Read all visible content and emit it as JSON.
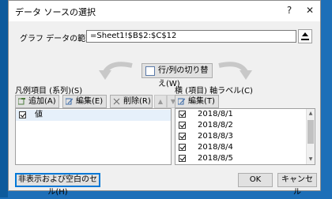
{
  "window": {
    "title": "データ ソースの選択",
    "help": "?",
    "close": "✕"
  },
  "range": {
    "label": "グラフ データの範囲(D):",
    "value": "=Sheet1!$B$2:$C$12"
  },
  "switch_button": "行/列の切り替え(W)",
  "series_panel": {
    "title": "凡例項目 (系列)(S)",
    "add": "追加(A)",
    "edit": "編集(E)",
    "delete": "削除(R)",
    "items": [
      {
        "label": "値",
        "checked": true
      }
    ]
  },
  "axis_panel": {
    "title": "横 (項目) 軸ラベル(C)",
    "edit": "編集(T)",
    "items": [
      {
        "label": "2018/8/1",
        "checked": true
      },
      {
        "label": "2018/8/2",
        "checked": true
      },
      {
        "label": "2018/8/3",
        "checked": true
      },
      {
        "label": "2018/8/4",
        "checked": true
      },
      {
        "label": "2018/8/5",
        "checked": true
      }
    ]
  },
  "footer": {
    "hidden_cells": "非表示および空白のセル(H)",
    "ok": "OK",
    "cancel": "キャンセル"
  }
}
